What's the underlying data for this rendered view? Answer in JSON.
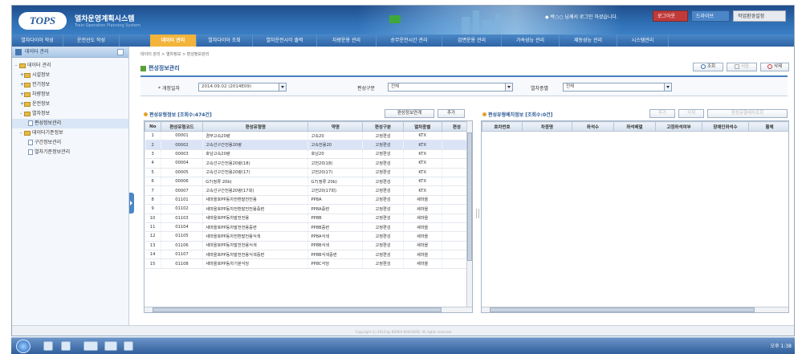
{
  "header": {
    "logo": "TOPS",
    "title": "열차운영계획시스템",
    "subtitle": "Train Operation Planning System",
    "userinfo": "◆ 박○○ 님께서 로그인 하셨습니다.",
    "buttons": [
      "로그아웃",
      "드라이브",
      "작업환경설정"
    ]
  },
  "menu": [
    "열차다이아 작성",
    "운전선도 작성",
    "데이터 관리",
    "열차다이아 조회",
    "열차운전시각 출력",
    "차량운용 관리",
    "승무운전시간 관리",
    "검면운용 관리",
    "가속성능 관리",
    "제동성능 관리",
    "시스템관리"
  ],
  "sidebar": {
    "title": "데이터 관리",
    "tree": [
      {
        "label": "데이터 관리",
        "level": 0,
        "type": "folder",
        "exp": "-"
      },
      {
        "label": "시설정보",
        "level": 1,
        "type": "folder",
        "exp": "+"
      },
      {
        "label": "전기정보",
        "level": 1,
        "type": "folder",
        "exp": "+"
      },
      {
        "label": "차량정보",
        "level": 1,
        "type": "folder",
        "exp": "+"
      },
      {
        "label": "운전정보",
        "level": 1,
        "type": "folder",
        "exp": "+"
      },
      {
        "label": "열차정보",
        "level": 1,
        "type": "folder",
        "exp": "-"
      },
      {
        "label": "편성정보관리",
        "level": 2,
        "type": "doc",
        "selected": true
      },
      {
        "label": "데이터기준정보",
        "level": 1,
        "type": "folder",
        "exp": "-"
      },
      {
        "label": "구간정보관리",
        "level": 2,
        "type": "doc"
      },
      {
        "label": "열차기준정보관리",
        "level": 2,
        "type": "doc"
      }
    ]
  },
  "content": {
    "breadcrumb": "데이터 관리 > 열차정보 > 편성정보관리",
    "title": "편성정보관리",
    "buttons": {
      "search": "조회",
      "save": "저장",
      "delete": "삭제"
    },
    "filter": {
      "date_label": "* 개정일자",
      "date_value": "2014.09.02 (2014E09)",
      "type_label": "편성구분",
      "type_value": "전체",
      "train_label": "열차종별",
      "train_value": "전체"
    }
  },
  "left_panel": {
    "title": "편성유형정보 [조회수:474건]",
    "btn_link": "편성정보연계",
    "btn_add": "추가",
    "columns": [
      "No",
      "편성유형코드",
      "편성유형명",
      "약명",
      "편성구분",
      "열차종별",
      "편성"
    ],
    "rows": [
      [
        "1",
        "00001",
        "경부고속20량",
        "고속20",
        "고정편성",
        "KTX",
        ""
      ],
      [
        "2",
        "00002",
        "고속선구간전용20량",
        "고속전용20",
        "고정편성",
        "KTX",
        ""
      ],
      [
        "3",
        "00003",
        "호남고속20량",
        "호남20",
        "고정편성",
        "KTX",
        ""
      ],
      [
        "4",
        "00004",
        "고속선구간전용20량(18)",
        "고전20(18)",
        "고정편성",
        "KTX",
        ""
      ],
      [
        "5",
        "00005",
        "고속선구간전용20량(17)",
        "고전20(17)",
        "고정편성",
        "KTX",
        ""
      ],
      [
        "6",
        "00006",
        "G7(정류 20b)",
        "G7(정류 20b)",
        "고정편성",
        "KTX",
        ""
      ],
      [
        "7",
        "00007",
        "고속선구간전용20량(17회)",
        "고전20(17회)",
        "고정편성",
        "KTX",
        ""
      ],
      [
        "8",
        "01101",
        "새마을호PP동차전환발전전용",
        "PP8A",
        "고정편성",
        "새마을",
        ""
      ],
      [
        "9",
        "01102",
        "새마을호PP동차전환발전전용중련",
        "PP8A중련",
        "고정편성",
        "새마을",
        ""
      ],
      [
        "10",
        "01103",
        "새마을호PP동차발전전용",
        "PP8B",
        "고정편성",
        "새마을",
        ""
      ],
      [
        "11",
        "01104",
        "새마을호PP동차발전전용중련",
        "PP8B중련",
        "고정편성",
        "새마을",
        ""
      ],
      [
        "12",
        "01105",
        "새마을호PP동차전환발전용식색",
        "PP8A식색",
        "고정편성",
        "새마을",
        ""
      ],
      [
        "13",
        "01106",
        "새마을호PP동차발전전용식색",
        "PP8B식색",
        "고정편성",
        "새마을",
        ""
      ],
      [
        "14",
        "01107",
        "새마을호PP동차발전전용식색중련",
        "PP8B식색중련",
        "고정편성",
        "새마을",
        ""
      ],
      [
        "15",
        "01108",
        "새마을호PP동차기분식당",
        "PP8C식당",
        "고정편성",
        "새마을",
        ""
      ]
    ]
  },
  "right_panel": {
    "title": "편성유형배치정보 [조회수:0건]",
    "btn_add": "추가",
    "btn_delete": "삭제",
    "btn_detail": "편성유형배치조회",
    "columns": [
      "호차번호",
      "차종명",
      "좌석수",
      "좌석배열",
      "고정좌석여부",
      "장애인좌석수",
      "휠체"
    ]
  },
  "footer": "Copyright (c) 2013 by KOREA RAILROAD. All rights reserved.",
  "taskbar": {
    "clock": "오후 1:38"
  },
  "colors": {
    "menu_active": "#f2b43b",
    "header": "#2f6fb4",
    "selected_row": "#dbe4f7"
  }
}
